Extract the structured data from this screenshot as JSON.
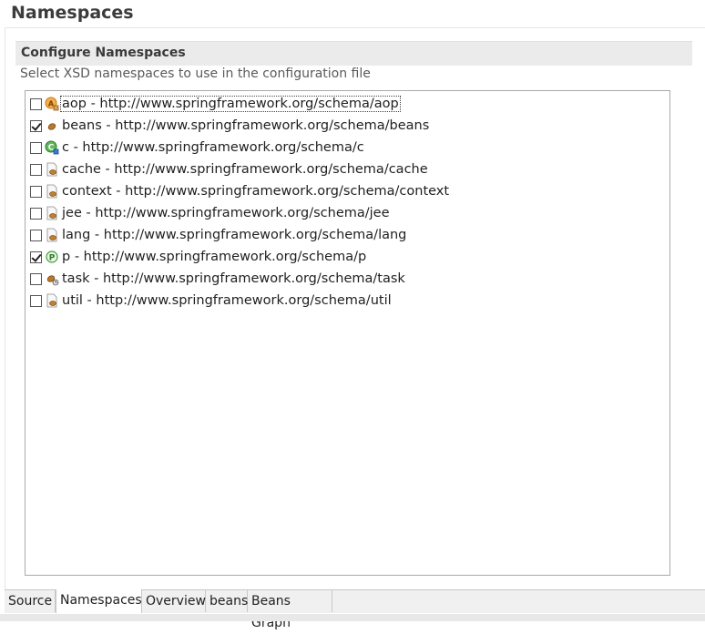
{
  "page": {
    "title": "Namespaces"
  },
  "section": {
    "title": "Configure Namespaces",
    "description": "Select XSD namespaces to use in the configuration file"
  },
  "namespaces": [
    {
      "label": "aop - http://www.springframework.org/schema/aop",
      "checked": false,
      "icon": "aop-icon",
      "focused": true
    },
    {
      "label": "beans - http://www.springframework.org/schema/beans",
      "checked": true,
      "icon": "bean-icon"
    },
    {
      "label": "c - http://www.springframework.org/schema/c",
      "checked": false,
      "icon": "c-namespace-icon"
    },
    {
      "label": "cache - http://www.springframework.org/schema/cache",
      "checked": false,
      "icon": "xsd-file-icon"
    },
    {
      "label": "context - http://www.springframework.org/schema/context",
      "checked": false,
      "icon": "xsd-file-icon"
    },
    {
      "label": "jee - http://www.springframework.org/schema/jee",
      "checked": false,
      "icon": "xsd-file-icon"
    },
    {
      "label": "lang - http://www.springframework.org/schema/lang",
      "checked": false,
      "icon": "xsd-file-icon"
    },
    {
      "label": "p - http://www.springframework.org/schema/p",
      "checked": true,
      "icon": "p-namespace-icon"
    },
    {
      "label": "task - http://www.springframework.org/schema/task",
      "checked": false,
      "icon": "task-icon"
    },
    {
      "label": "util - http://www.springframework.org/schema/util",
      "checked": false,
      "icon": "xsd-file-icon"
    }
  ],
  "tabs": [
    {
      "label": "Source",
      "active": false
    },
    {
      "label": "Namespaces",
      "active": true
    },
    {
      "label": "Overview",
      "active": false
    },
    {
      "label": "beans",
      "active": false
    },
    {
      "label": "Beans Graph",
      "active": false
    }
  ],
  "colors": {
    "section_header_bg": "#ebebeb",
    "list_border": "#a9a9a9",
    "tab_bar_bg": "#f0f0f0"
  }
}
